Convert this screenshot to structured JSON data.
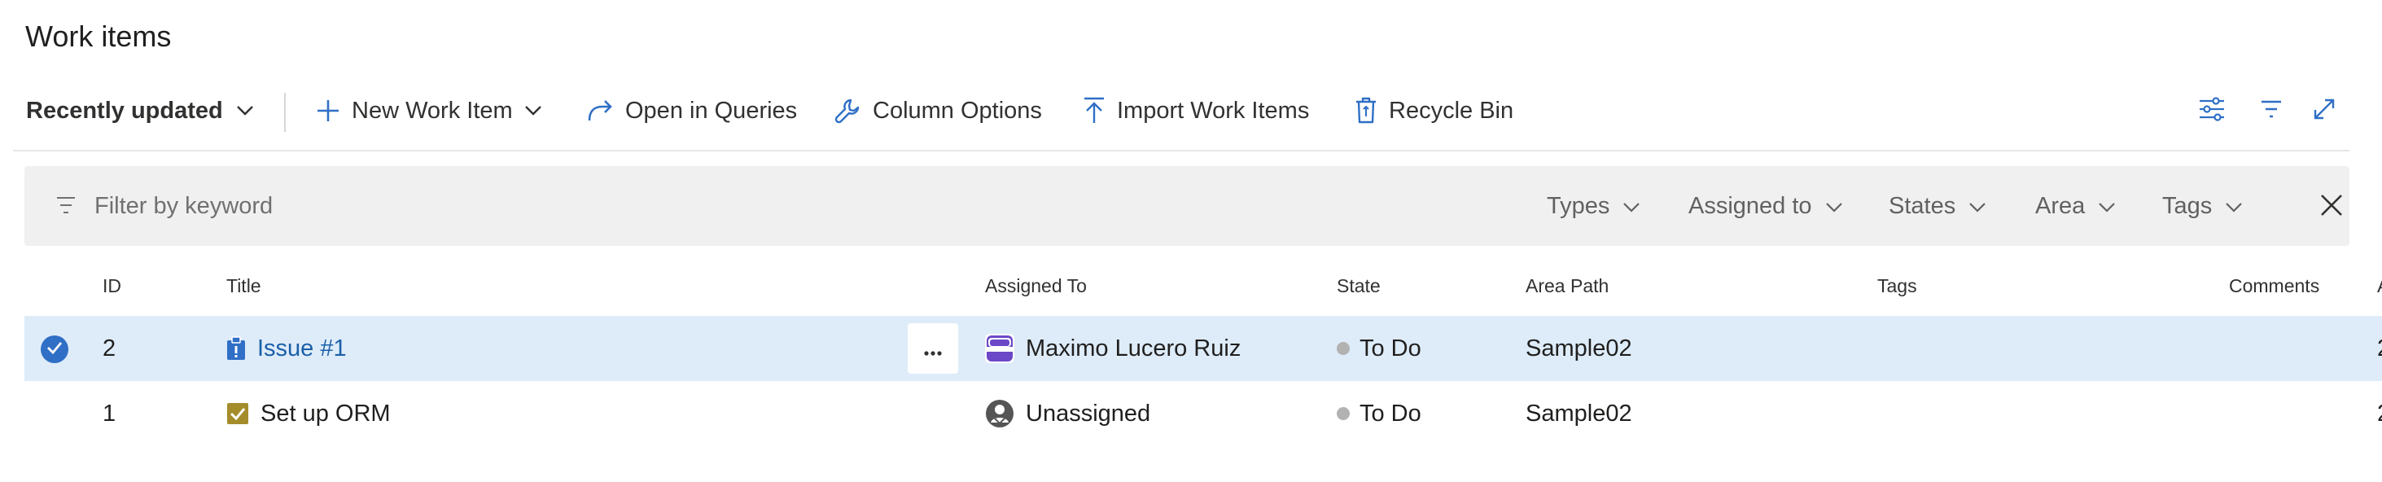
{
  "page": {
    "title": "Work items"
  },
  "toolbar": {
    "view_selector": {
      "label": "Recently updated",
      "icon": "chevron-down-icon"
    },
    "new_work_item": {
      "label": "New Work Item",
      "icon": "plus-icon"
    },
    "open_in_queries": {
      "label": "Open in Queries",
      "icon": "redo-arrow-icon"
    },
    "column_options": {
      "label": "Column Options",
      "icon": "wrench-icon"
    },
    "import_work_items": {
      "label": "Import Work Items",
      "icon": "upload-arrow-icon"
    },
    "recycle_bin": {
      "label": "Recycle Bin",
      "icon": "recycle-bin-icon"
    },
    "right_icons": [
      "view-options-icon",
      "filter-icon",
      "fullscreen-icon"
    ]
  },
  "filter": {
    "placeholder": "Filter by keyword",
    "dropdowns": [
      "Types",
      "Assigned to",
      "States",
      "Area",
      "Tags"
    ],
    "close_icon": "close-icon"
  },
  "table": {
    "columns": {
      "id": "ID",
      "title": "Title",
      "assigned_to": "Assigned To",
      "state": "State",
      "area_path": "Area Path",
      "tags": "Tags",
      "comments": "Comments",
      "activity": "A"
    },
    "rows": [
      {
        "selected": true,
        "id": "2",
        "type_icon": "issue-icon",
        "type_color": "#2f6fc6",
        "title": "Issue #1",
        "assigned_to": "Maximo Lucero Ruiz",
        "avatar_icon": "user-avatar-icon",
        "state": "To Do",
        "area_path": "Sample02",
        "tags": "",
        "comments": "",
        "activity": "2"
      },
      {
        "selected": false,
        "id": "1",
        "type_icon": "task-icon",
        "type_color": "#a48c2b",
        "title": "Set up ORM",
        "assigned_to": "Unassigned",
        "avatar_icon": "unassigned-avatar-icon",
        "state": "To Do",
        "area_path": "Sample02",
        "tags": "",
        "comments": "",
        "activity": "2"
      }
    ]
  },
  "colors": {
    "accent": "#2f6fc6",
    "link": "#1a5fa8",
    "selected_row": "#deecf9",
    "filter_bg": "#f0f0f0",
    "state_todo": "#b2b2b2"
  }
}
